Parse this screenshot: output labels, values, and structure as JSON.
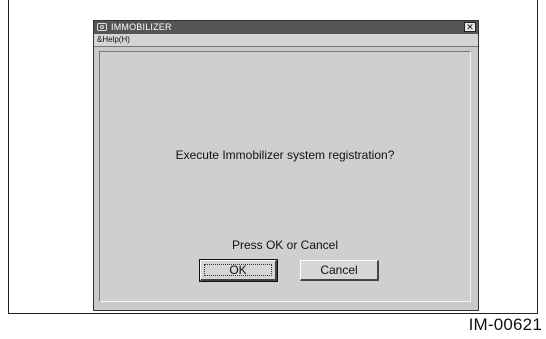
{
  "window": {
    "title": "IMMOBILIZER",
    "close_glyph": "✕"
  },
  "menu": {
    "help_label": "&Help(H)"
  },
  "dialog": {
    "question": "Execute Immobilizer system registration?",
    "prompt": "Press OK or Cancel",
    "ok_label": "OK",
    "cancel_label": "Cancel"
  },
  "figure_id": "IM-00621",
  "icons": {
    "app": "app-icon",
    "close": "close-icon"
  },
  "colors": {
    "titlebar": "#555555",
    "window_bg": "#c9c9c9"
  }
}
